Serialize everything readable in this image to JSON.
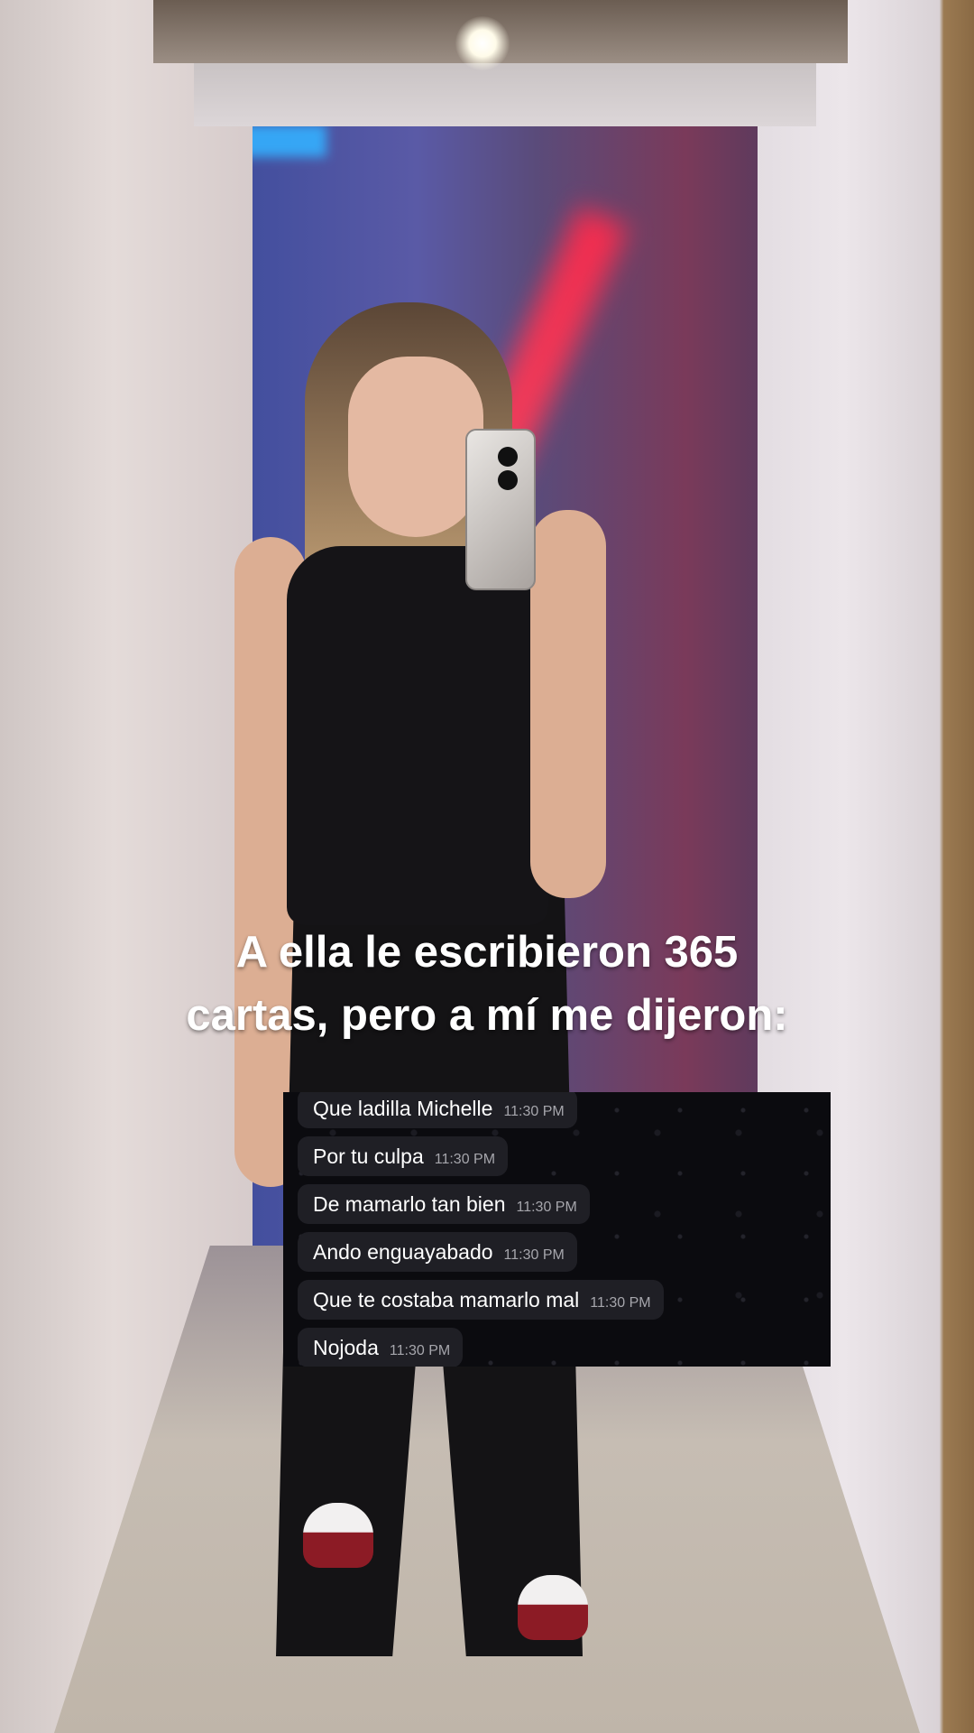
{
  "caption": {
    "line1": "A ella le escribieron 365",
    "line2": "cartas, pero a mí me dijeron:"
  },
  "chat": {
    "messages": [
      {
        "text": "Que ladilla Michelle",
        "time": "11:30 PM"
      },
      {
        "text": "Por tu culpa",
        "time": "11:30 PM"
      },
      {
        "text": "De mamarlo tan bien",
        "time": "11:30 PM"
      },
      {
        "text": "Ando enguayabado",
        "time": "11:30 PM"
      },
      {
        "text": "Que te costaba mamarlo mal",
        "time": "11:30 PM"
      },
      {
        "text": "Nojoda",
        "time": "11:30 PM"
      }
    ]
  },
  "colors": {
    "caption_text": "#ffffff",
    "chat_background": "#0b0b0f",
    "bubble": "#1f1f25",
    "timestamp": "#a6a6ac",
    "neon_red": "#ff2a4c",
    "neon_blue": "#34b0ff"
  }
}
